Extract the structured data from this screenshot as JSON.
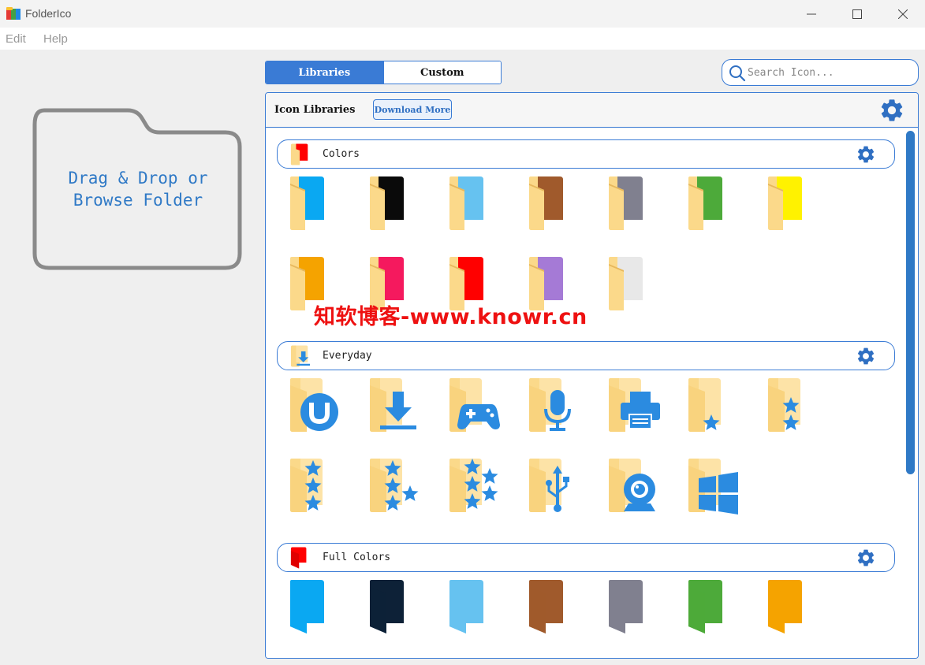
{
  "window": {
    "title": "FolderIco"
  },
  "menu": {
    "edit": "Edit",
    "help": "Help"
  },
  "dropzone": {
    "line1": "Drag & Drop or",
    "line2": "Browse Folder"
  },
  "tabs": {
    "libraries": "Libraries",
    "custom": "Custom"
  },
  "search": {
    "placeholder": "Search Icon..."
  },
  "panel": {
    "title": "Icon Libraries",
    "download_label": "Download More"
  },
  "sections": [
    {
      "label": "Colors",
      "icon": "red-folder-icon",
      "folders": [
        {
          "color": "#0aa8f2",
          "type": "color"
        },
        {
          "color": "#0a0a0a",
          "type": "color"
        },
        {
          "color": "#66c2f0",
          "type": "color"
        },
        {
          "color": "#a05a2c",
          "type": "color"
        },
        {
          "color": "#80808f",
          "type": "color"
        },
        {
          "color": "#4daa3a",
          "type": "color"
        },
        {
          "color": "#fff200",
          "type": "color"
        },
        {
          "color": "#f5a300",
          "type": "color"
        },
        {
          "color": "#f5195e",
          "type": "color"
        },
        {
          "color": "#ff0000",
          "type": "color"
        },
        {
          "color": "#a57ad6",
          "type": "color"
        },
        {
          "color": "#e8e8e8",
          "type": "color"
        }
      ]
    },
    {
      "label": "Everyday",
      "icon": "download-folder-icon",
      "folders": [
        {
          "type": "utorrent"
        },
        {
          "type": "download"
        },
        {
          "type": "gamepad"
        },
        {
          "type": "microphone"
        },
        {
          "type": "printer"
        },
        {
          "type": "star1"
        },
        {
          "type": "star2"
        },
        {
          "type": "star3"
        },
        {
          "type": "star4"
        },
        {
          "type": "star5"
        },
        {
          "type": "usb"
        },
        {
          "type": "webcam"
        },
        {
          "type": "windows"
        }
      ]
    },
    {
      "label": "Full Colors",
      "icon": "red-full-folder-icon",
      "folders": [
        {
          "color": "#0aa8f2",
          "type": "full"
        },
        {
          "color": "#0d2137",
          "type": "full"
        },
        {
          "color": "#66c2f0",
          "type": "full"
        },
        {
          "color": "#a05a2c",
          "type": "full"
        },
        {
          "color": "#80808f",
          "type": "full"
        },
        {
          "color": "#4daa3a",
          "type": "full"
        },
        {
          "color": "#f5a300",
          "type": "full"
        }
      ]
    }
  ],
  "watermark": "知软博客-www.knowr.cn",
  "colors": {
    "accent": "#3a7bd5",
    "folder_yellow": "#fbd98a"
  }
}
